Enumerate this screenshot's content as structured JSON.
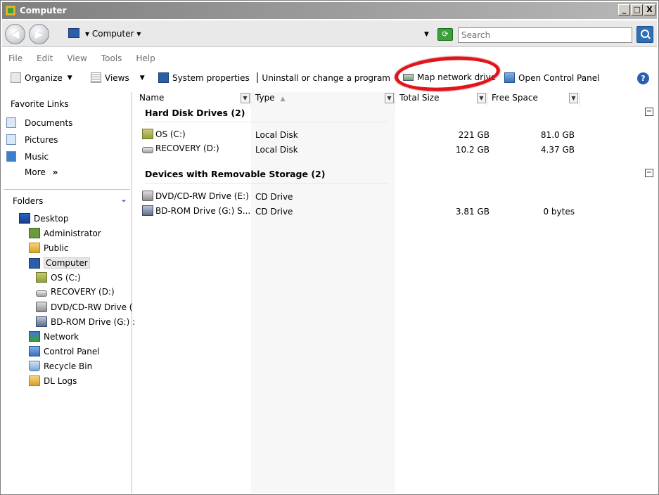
{
  "window": {
    "title": "Computer"
  },
  "title_buttons": {
    "minimize": "_",
    "maximize": "□",
    "close": "X"
  },
  "address": {
    "path": "Computer",
    "search_placeholder": "Search"
  },
  "menu": [
    "File",
    "Edit",
    "View",
    "Tools",
    "Help"
  ],
  "toolbar": {
    "organize": "Organize",
    "views": "Views",
    "system_properties": "System properties",
    "uninstall": "Uninstall or change a program",
    "map_network_drive": "Map network drive",
    "open_control_panel": "Open Control Panel"
  },
  "favorites": {
    "header": "Favorite Links",
    "items": [
      "Documents",
      "Pictures",
      "Music"
    ],
    "more": "More"
  },
  "folders": {
    "header": "Folders",
    "items": [
      "Desktop",
      "Administrator",
      "Public",
      "Computer",
      "OS (C:)",
      "RECOVERY (D:)",
      "DVD/CD-RW Drive (",
      "BD-ROM Drive (G:) :",
      "Network",
      "Control Panel",
      "Recycle Bin",
      "DL Logs"
    ]
  },
  "columns": {
    "name": "Name",
    "type": "Type",
    "total": "Total Size",
    "free": "Free Space"
  },
  "groups": [
    {
      "header": "Hard Disk Drives (2)",
      "rows": [
        {
          "name": "OS (C:)",
          "type": "Local Disk",
          "total": "221 GB",
          "free": "81.0 GB"
        },
        {
          "name": "RECOVERY (D:)",
          "type": "Local Disk",
          "total": "10.2 GB",
          "free": "4.37 GB"
        }
      ]
    },
    {
      "header": "Devices with Removable Storage (2)",
      "rows": [
        {
          "name": "DVD/CD-RW Drive (E:)",
          "type": "CD Drive",
          "total": "",
          "free": ""
        },
        {
          "name": "BD-ROM Drive (G:) S...",
          "type": "CD Drive",
          "total": "3.81 GB",
          "free": "0 bytes"
        }
      ]
    }
  ],
  "colors": {
    "annotation": "#e0141a",
    "titlebar": "#7f7f7f",
    "folder_chevron": "#1b4f9a"
  }
}
